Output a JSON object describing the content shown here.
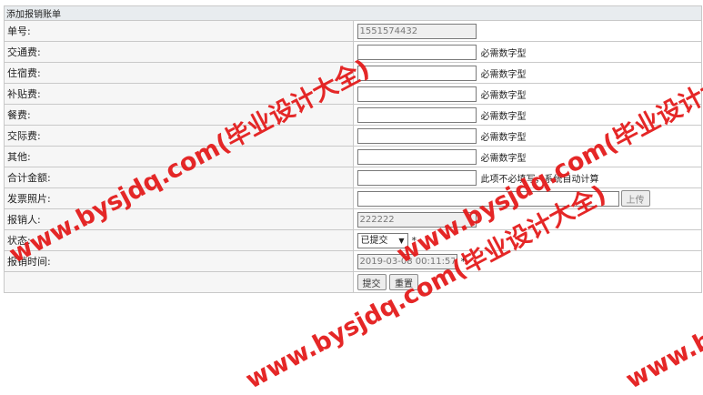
{
  "form": {
    "title": "添加报销账单",
    "labels": {
      "order_no": "单号:",
      "transport": "交通费:",
      "lodging": "住宿费:",
      "subsidy": "补贴费:",
      "meal": "餐费:",
      "social": "交际费:",
      "other": "其他:",
      "total": "合计金额:",
      "invoice_photo": "发票照片:",
      "reimburser": "报销人:",
      "status": "状态:",
      "reimburse_time": "报销时间:"
    },
    "values": {
      "order_no": "1551574432",
      "transport": "",
      "lodging": "",
      "subsidy": "",
      "meal": "",
      "social": "",
      "other": "",
      "total": "",
      "invoice_photo": "",
      "reimburser": "222222",
      "status": "已提交",
      "reimburse_time": "2019-03-08 00:11:57"
    },
    "hint_numeric": "必需数字型",
    "hint_total": "此项不必填写，系统自动计算",
    "upload_button": "上传",
    "required_mark": "*",
    "submit_button": "提交",
    "reset_button": "重置"
  },
  "watermark": {
    "text": "www.bysjdq.com(毕业设计大全)",
    "color": "#e41c1c"
  }
}
